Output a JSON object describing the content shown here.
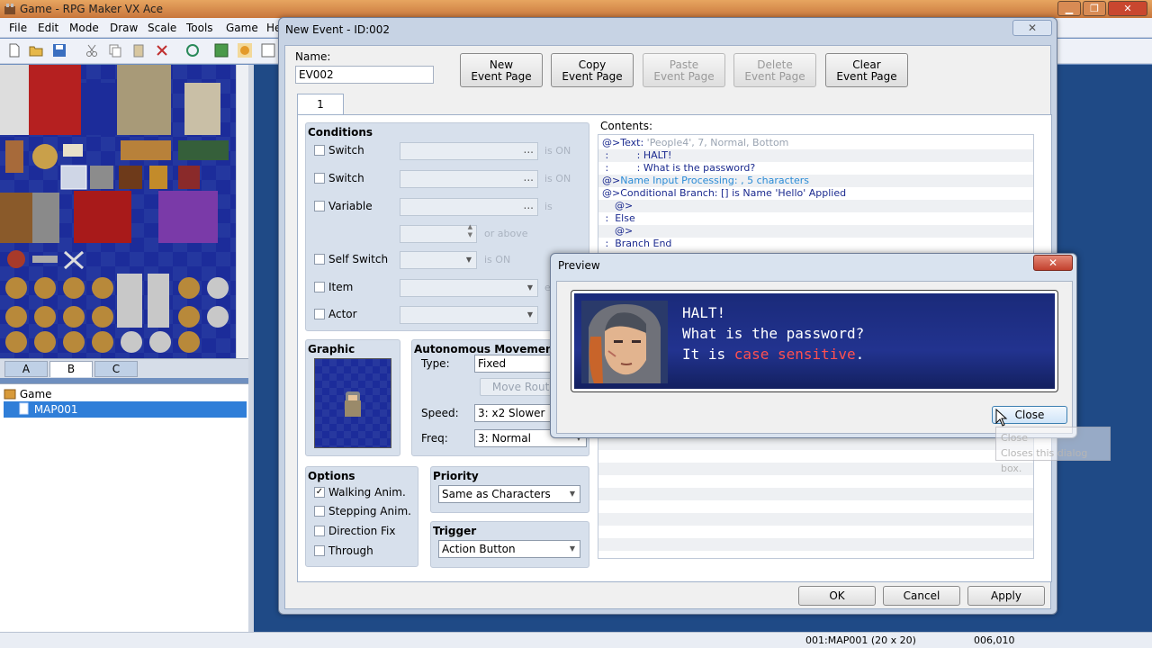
{
  "app": {
    "title": "Game - RPG Maker VX Ace",
    "menu": [
      "File",
      "Edit",
      "Mode",
      "Draw",
      "Scale",
      "Tools",
      "Game",
      "He"
    ]
  },
  "left_panel": {
    "tabs": [
      "A",
      "B",
      "C"
    ],
    "active_tab": "B",
    "tree": {
      "root": "Game",
      "selected": "MAP001"
    }
  },
  "statusbar": {
    "map": "001:MAP001 (20 x 20)",
    "coords": "006,010"
  },
  "event_dialog": {
    "title": "New Event - ID:002",
    "close_label": "✕",
    "name_label": "Name:",
    "name_value": "EV002",
    "buttons": {
      "new_page": [
        "New",
        "Event Page"
      ],
      "copy_page": [
        "Copy",
        "Event Page"
      ],
      "paste_page": [
        "Paste",
        "Event Page"
      ],
      "delete_page": [
        "Delete",
        "Event Page"
      ],
      "clear_page": [
        "Clear",
        "Event Page"
      ]
    },
    "page_tab": "1",
    "conditions": {
      "title": "Conditions",
      "rows": [
        {
          "label": "Switch",
          "suffix": "is ON"
        },
        {
          "label": "Switch",
          "suffix": "is ON"
        },
        {
          "label": "Variable",
          "suffix": "is"
        },
        {
          "label": "",
          "suffix": "or above"
        },
        {
          "label": "Self Switch",
          "suffix": "is ON"
        },
        {
          "label": "Item",
          "suffix": "e"
        },
        {
          "label": "Actor",
          "suffix": ""
        }
      ]
    },
    "graphic": {
      "title": "Graphic"
    },
    "movement": {
      "title": "Autonomous Movement",
      "type_label": "Type:",
      "type_value": "Fixed",
      "move_route": "Move Route...",
      "speed_label": "Speed:",
      "speed_value": "3: x2 Slower",
      "freq_label": "Freq:",
      "freq_value": "3: Normal"
    },
    "options": {
      "title": "Options",
      "items": [
        {
          "label": "Walking Anim.",
          "checked": true
        },
        {
          "label": "Stepping Anim.",
          "checked": false
        },
        {
          "label": "Direction Fix",
          "checked": false
        },
        {
          "label": "Through",
          "checked": false
        }
      ]
    },
    "priority": {
      "title": "Priority",
      "value": "Same as Characters"
    },
    "trigger": {
      "title": "Trigger",
      "value": "Action Button"
    },
    "contents": {
      "label": "Contents:",
      "lines": [
        {
          "prefix": "@>Text: ",
          "text": "'People4', 7, Normal, Bottom",
          "color": "#9aa4b2"
        },
        {
          "prefix": " :         : ",
          "text": "HALT!",
          "color": "#1b2a8f"
        },
        {
          "prefix": " :         : ",
          "text": "What is the password?",
          "color": "#1b2a8f"
        },
        {
          "prefix": "@>",
          "text": "Name Input Processing: , 5 characters",
          "color": "#2a8bd6"
        },
        {
          "prefix": "@>",
          "text": "Conditional Branch: [] is Name 'Hello' Applied",
          "color": "#1b2a8f"
        },
        {
          "prefix": "    @>",
          "text": "",
          "color": "#1b2a8f"
        },
        {
          "prefix": " :  ",
          "text": "Else",
          "color": "#1b2a8f"
        },
        {
          "prefix": "    @>",
          "text": "",
          "color": "#1b2a8f"
        },
        {
          "prefix": " :  ",
          "text": "Branch End",
          "color": "#1b2a8f"
        }
      ]
    },
    "footer": {
      "ok": "OK",
      "cancel": "Cancel",
      "apply": "Apply"
    }
  },
  "preview": {
    "title": "Preview",
    "close_x": "✕",
    "message_line1": "HALT!",
    "message_line2": "What is the password?",
    "message_line3_a": "It is ",
    "message_line3_red": "case sensitive",
    "message_line3_b": ".",
    "close_button": "Close",
    "tooltip_title": "Close",
    "tooltip_text": "Closes this dialog box."
  }
}
